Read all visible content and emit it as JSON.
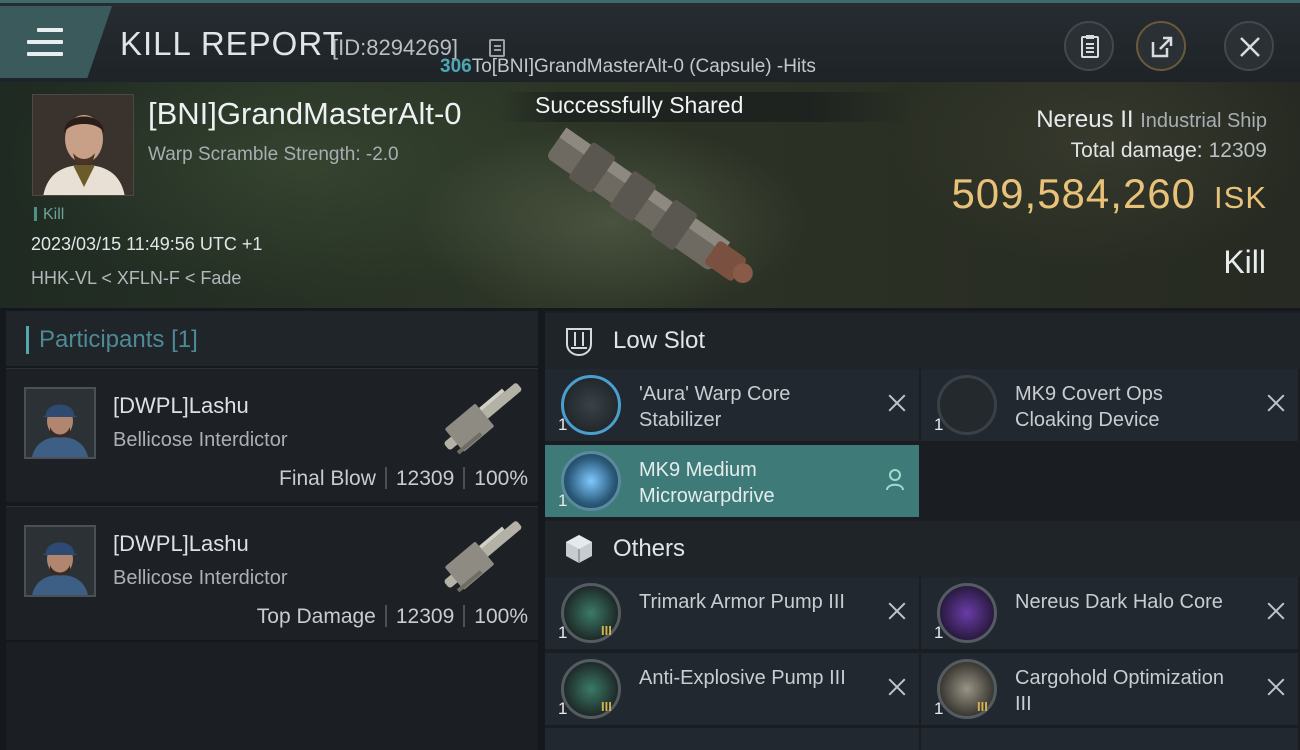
{
  "header": {
    "title": "KILL REPORT",
    "report_id": "[ID:8294269]",
    "hits_count": "306",
    "hits_text": "To[BNI]GrandMasterAlt-0 (Capsule) -Hits",
    "icons": [
      "menu-icon",
      "clipboard-icon",
      "share-icon",
      "close-icon"
    ]
  },
  "victim": {
    "name": "[BNI]GrandMasterAlt-0",
    "warp_scramble": "Warp Scramble Strength: -2.0",
    "tag": "Kill",
    "timestamp": "2023/03/15 11:49:56 UTC +1",
    "location": "HHK-VL < XFLN-F < Fade"
  },
  "toast": "Successfully Shared",
  "ship": {
    "name": "Nereus II",
    "class": "Industrial Ship",
    "total_damage_label": "Total damage:",
    "total_damage": "12309",
    "isk_value": "509,584,260",
    "isk_unit": "ISK",
    "result": "Kill"
  },
  "participants": {
    "title": "Participants",
    "count": "[1]",
    "items": [
      {
        "name": "[DWPL]Lashu",
        "ship": "Bellicose Interdictor",
        "role": "Final Blow",
        "damage": "12309",
        "percent": "100%"
      },
      {
        "name": "[DWPL]Lashu",
        "ship": "Bellicose Interdictor",
        "role": "Top Damage",
        "damage": "12309",
        "percent": "100%"
      }
    ]
  },
  "sections": {
    "low_slot": {
      "label": "Low Slot",
      "modules": [
        {
          "name": "'Aura' Warp Core Stabilizer",
          "qty": "1",
          "status": "destroyed",
          "tier": ""
        },
        {
          "name": "MK9 Covert Ops Cloaking Device",
          "qty": "1",
          "status": "destroyed",
          "tier": ""
        },
        {
          "name": "MK9 Medium Microwarpdrive",
          "qty": "1",
          "status": "dropped",
          "tier": ""
        }
      ]
    },
    "others": {
      "label": "Others",
      "modules": [
        {
          "name": "Trimark Armor Pump III",
          "qty": "1",
          "status": "destroyed",
          "tier": "III"
        },
        {
          "name": "Nereus Dark Halo Core",
          "qty": "1",
          "status": "destroyed",
          "tier": ""
        },
        {
          "name": "Anti-Explosive Pump III",
          "qty": "1",
          "status": "destroyed",
          "tier": "III"
        },
        {
          "name": "Cargohold Optimization III",
          "qty": "1",
          "status": "destroyed",
          "tier": "III"
        }
      ]
    }
  },
  "colors": {
    "accent": "#3e7a78",
    "isk": "#e9c27a",
    "participants": "#4e8a94"
  }
}
